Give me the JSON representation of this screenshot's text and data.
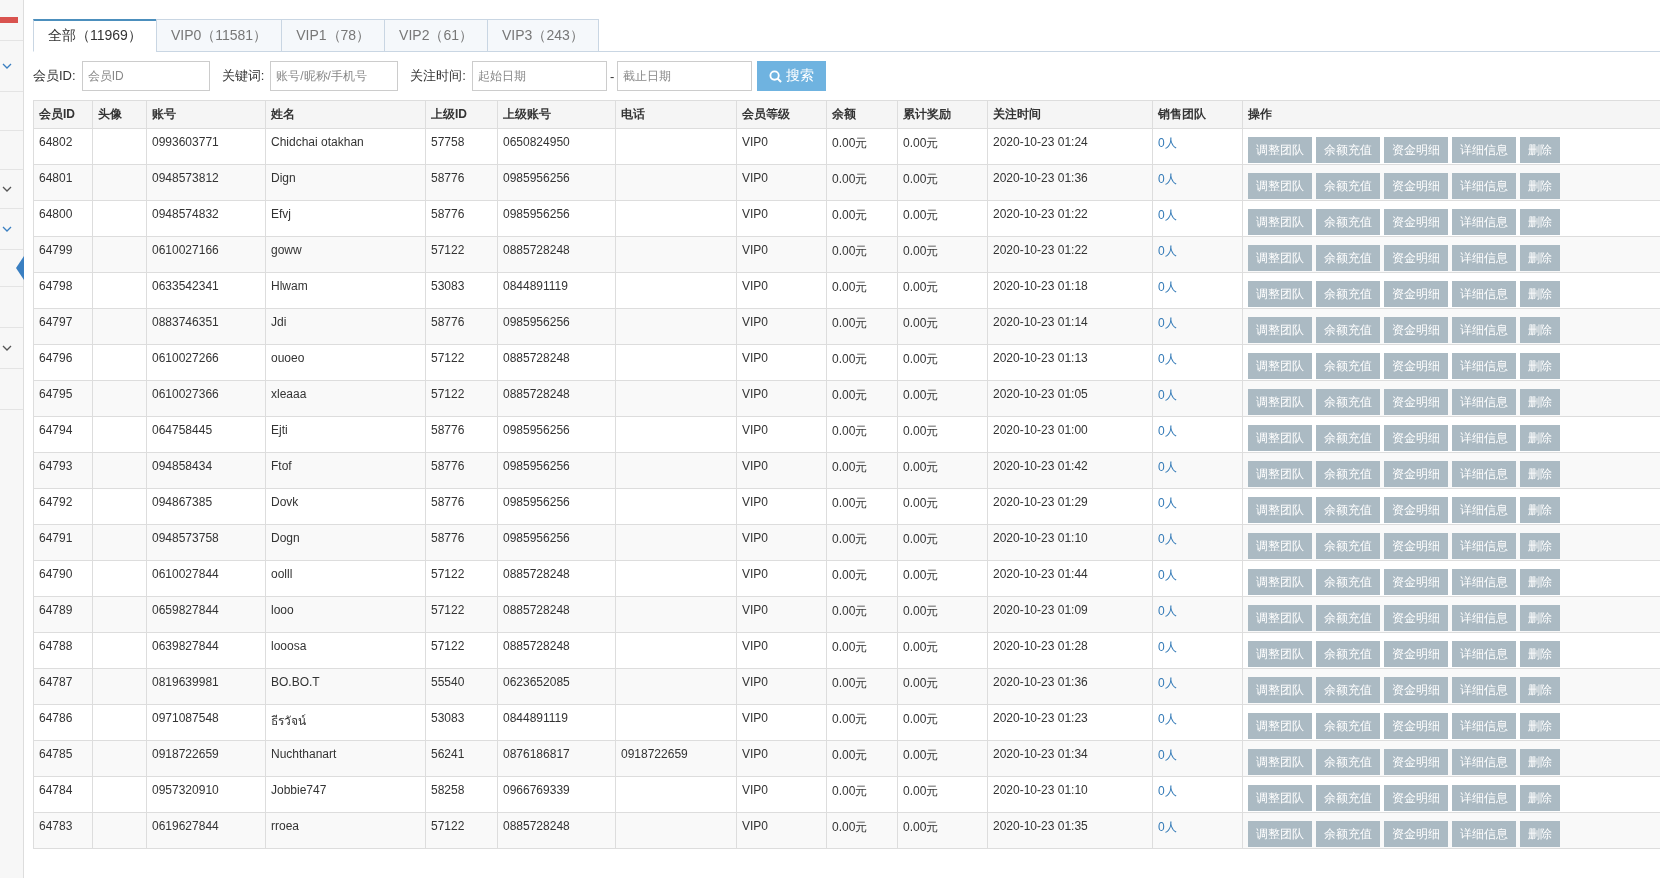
{
  "tabs": [
    {
      "label": "全部（11969）",
      "selected": true
    },
    {
      "label": "VIP0（11581）",
      "selected": false
    },
    {
      "label": "VIP1（78）",
      "selected": false
    },
    {
      "label": "VIP2（61）",
      "selected": false
    },
    {
      "label": "VIP3（243）",
      "selected": false
    }
  ],
  "filters": {
    "member_id": {
      "label": "会员ID:",
      "placeholder": "会员ID"
    },
    "keyword": {
      "label": "关键词:",
      "placeholder": "账号/昵称/手机号"
    },
    "follow_time": {
      "label": "关注时间:",
      "start_placeholder": "起始日期",
      "separator": "-",
      "end_placeholder": "截止日期"
    },
    "search_button": "搜索"
  },
  "table": {
    "columns": [
      "会员ID",
      "头像",
      "账号",
      "姓名",
      "上级ID",
      "上级账号",
      "电话",
      "会员等级",
      "余额",
      "累计奖励",
      "关注时间",
      "销售团队",
      "操作"
    ],
    "rows": [
      {
        "cells": [
          "64802",
          "",
          "0993603771",
          "Chidchai otakhan",
          "57758",
          "0650824950",
          "",
          "VIP0",
          "0.00元",
          "0.00元",
          "2020-10-23 01:24"
        ],
        "team": "0人",
        "actions": [
          "调整团队",
          "余额充值",
          "资金明细",
          "详细信息",
          "删除"
        ]
      },
      {
        "cells": [
          "64801",
          "",
          "0948573812",
          "Dign",
          "58776",
          "0985956256",
          "",
          "VIP0",
          "0.00元",
          "0.00元",
          "2020-10-23 01:36"
        ],
        "team": "0人",
        "actions": [
          "调整团队",
          "余额充值",
          "资金明细",
          "详细信息",
          "删除"
        ]
      },
      {
        "cells": [
          "64800",
          "",
          "0948574832",
          "Efvj",
          "58776",
          "0985956256",
          "",
          "VIP0",
          "0.00元",
          "0.00元",
          "2020-10-23 01:22"
        ],
        "team": "0人",
        "actions": [
          "调整团队",
          "余额充值",
          "资金明细",
          "详细信息",
          "删除"
        ]
      },
      {
        "cells": [
          "64799",
          "",
          "0610027166",
          "goww",
          "57122",
          "0885728248",
          "",
          "VIP0",
          "0.00元",
          "0.00元",
          "2020-10-23 01:22"
        ],
        "team": "0人",
        "actions": [
          "调整团队",
          "余额充值",
          "资金明细",
          "详细信息",
          "删除"
        ]
      },
      {
        "cells": [
          "64798",
          "",
          "0633542341",
          "Hlwam",
          "53083",
          "0844891119",
          "",
          "VIP0",
          "0.00元",
          "0.00元",
          "2020-10-23 01:18"
        ],
        "team": "0人",
        "actions": [
          "调整团队",
          "余额充值",
          "资金明细",
          "详细信息",
          "删除"
        ]
      },
      {
        "cells": [
          "64797",
          "",
          "0883746351",
          "Jdi",
          "58776",
          "0985956256",
          "",
          "VIP0",
          "0.00元",
          "0.00元",
          "2020-10-23 01:14"
        ],
        "team": "0人",
        "actions": [
          "调整团队",
          "余额充值",
          "资金明细",
          "详细信息",
          "删除"
        ]
      },
      {
        "cells": [
          "64796",
          "",
          "0610027266",
          "ouoeo",
          "57122",
          "0885728248",
          "",
          "VIP0",
          "0.00元",
          "0.00元",
          "2020-10-23 01:13"
        ],
        "team": "0人",
        "actions": [
          "调整团队",
          "余额充值",
          "资金明细",
          "详细信息",
          "删除"
        ]
      },
      {
        "cells": [
          "64795",
          "",
          "0610027366",
          "xleaaa",
          "57122",
          "0885728248",
          "",
          "VIP0",
          "0.00元",
          "0.00元",
          "2020-10-23 01:05"
        ],
        "team": "0人",
        "actions": [
          "调整团队",
          "余额充值",
          "资金明细",
          "详细信息",
          "删除"
        ]
      },
      {
        "cells": [
          "64794",
          "",
          "064758445",
          "Ejti",
          "58776",
          "0985956256",
          "",
          "VIP0",
          "0.00元",
          "0.00元",
          "2020-10-23 01:00"
        ],
        "team": "0人",
        "actions": [
          "调整团队",
          "余额充值",
          "资金明细",
          "详细信息",
          "删除"
        ]
      },
      {
        "cells": [
          "64793",
          "",
          "094858434",
          "Ftof",
          "58776",
          "0985956256",
          "",
          "VIP0",
          "0.00元",
          "0.00元",
          "2020-10-23 01:42"
        ],
        "team": "0人",
        "actions": [
          "调整团队",
          "余额充值",
          "资金明细",
          "详细信息",
          "删除"
        ]
      },
      {
        "cells": [
          "64792",
          "",
          "094867385",
          "Dovk",
          "58776",
          "0985956256",
          "",
          "VIP0",
          "0.00元",
          "0.00元",
          "2020-10-23 01:29"
        ],
        "team": "0人",
        "actions": [
          "调整团队",
          "余额充值",
          "资金明细",
          "详细信息",
          "删除"
        ]
      },
      {
        "cells": [
          "64791",
          "",
          "0948573758",
          "Dogn",
          "58776",
          "0985956256",
          "",
          "VIP0",
          "0.00元",
          "0.00元",
          "2020-10-23 01:10"
        ],
        "team": "0人",
        "actions": [
          "调整团队",
          "余额充值",
          "资金明细",
          "详细信息",
          "删除"
        ]
      },
      {
        "cells": [
          "64790",
          "",
          "0610027844",
          "oolll",
          "57122",
          "0885728248",
          "",
          "VIP0",
          "0.00元",
          "0.00元",
          "2020-10-23 01:44"
        ],
        "team": "0人",
        "actions": [
          "调整团队",
          "余额充值",
          "资金明细",
          "详细信息",
          "删除"
        ]
      },
      {
        "cells": [
          "64789",
          "",
          "0659827844",
          "looo",
          "57122",
          "0885728248",
          "",
          "VIP0",
          "0.00元",
          "0.00元",
          "2020-10-23 01:09"
        ],
        "team": "0人",
        "actions": [
          "调整团队",
          "余额充值",
          "资金明细",
          "详细信息",
          "删除"
        ]
      },
      {
        "cells": [
          "64788",
          "",
          "0639827844",
          "looosa",
          "57122",
          "0885728248",
          "",
          "VIP0",
          "0.00元",
          "0.00元",
          "2020-10-23 01:28"
        ],
        "team": "0人",
        "actions": [
          "调整团队",
          "余额充值",
          "资金明细",
          "详细信息",
          "删除"
        ]
      },
      {
        "cells": [
          "64787",
          "",
          "0819639981",
          "BO.BO.T",
          "55540",
          "0623652085",
          "",
          "VIP0",
          "0.00元",
          "0.00元",
          "2020-10-23 01:36"
        ],
        "team": "0人",
        "actions": [
          "调整团队",
          "余额充值",
          "资金明细",
          "详细信息",
          "删除"
        ]
      },
      {
        "cells": [
          "64786",
          "",
          "0971087548",
          "ธีรวัจน์",
          "53083",
          "0844891119",
          "",
          "VIP0",
          "0.00元",
          "0.00元",
          "2020-10-23 01:23"
        ],
        "team": "0人",
        "actions": [
          "调整团队",
          "余额充值",
          "资金明细",
          "详细信息",
          "删除"
        ]
      },
      {
        "cells": [
          "64785",
          "",
          "0918722659",
          "Nuchthanart",
          "56241",
          "0876186817",
          "0918722659",
          "VIP0",
          "0.00元",
          "0.00元",
          "2020-10-23 01:34"
        ],
        "team": "0人",
        "actions": [
          "调整团队",
          "余额充值",
          "资金明细",
          "详细信息",
          "删除"
        ]
      },
      {
        "cells": [
          "64784",
          "",
          "0957320910",
          "Jobbie747",
          "58258",
          "0966769339",
          "",
          "VIP0",
          "0.00元",
          "0.00元",
          "2020-10-23 01:10"
        ],
        "team": "0人",
        "actions": [
          "调整团队",
          "余额充值",
          "资金明细",
          "详细信息",
          "删除"
        ]
      },
      {
        "cells": [
          "64783",
          "",
          "0619627844",
          "rroea",
          "57122",
          "0885728248",
          "",
          "VIP0",
          "0.00元",
          "0.00元",
          "2020-10-23 01:35"
        ],
        "team": "0人",
        "actions": [
          "调整团队",
          "余额充值",
          "资金明细",
          "详细信息",
          "删除"
        ]
      }
    ]
  }
}
